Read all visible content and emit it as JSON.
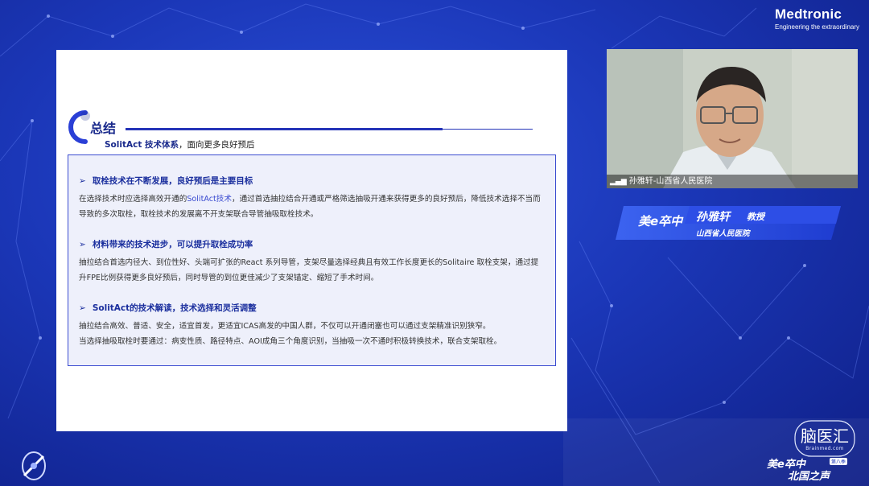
{
  "brand": {
    "name": "Medtronic",
    "tagline": "Engineering the extraordinary"
  },
  "slide": {
    "heading": "总结",
    "subtitle_em": "SolitAct 技术体系",
    "subtitle_rest": "，面向更多良好预后",
    "sections": [
      {
        "arrow": "➢",
        "title": "取栓技术在不断发展，良好预后是主要目标",
        "text_a": "在选择技术时应选择高效开通的",
        "text_hl": "SolitAct技术",
        "text_b": "，通过首选抽拉结合开通或严格筛选抽吸开通来获得更多的良好预后，降低技术选择不当而导致的多次取栓，取栓技术的发展离不开支架联合导管抽吸取栓技术。"
      },
      {
        "arrow": "➢",
        "title": "材料带来的技术进步，可以提升取栓成功率",
        "text": "抽拉结合首选内径大、到位性好、头端可扩张的React 系列导管，支架尽量选择经典且有效工作长度更长的Solitaire 取栓支架，通过提升FPE比例获得更多良好预后，同时导管的到位更佳减少了支架锚定、缩短了手术时间。"
      },
      {
        "arrow": "➢",
        "title": "SolitAct的技术解读，技术选择和灵活调整",
        "line1": "抽拉结合高效、普适、安全，适宜首发，更适宜ICAS高发的中国人群，不仅可以开通闭塞也可以通过支架精准识别狭窄。",
        "line2": "当选择抽吸取栓时要通过：病变性质、路径特点、AOI成角三个角度识别，当抽吸一次不通时积极转换技术，联合支架取栓。"
      }
    ]
  },
  "webcam": {
    "caption": "孙雅轩-山西省人民医院",
    "signal_icon": "signal-bars-icon"
  },
  "banner": {
    "brand": "美e卒中",
    "speaker_name": "孙雅轩",
    "speaker_title": "教授",
    "organization": "山西省人民医院"
  },
  "watermarks": {
    "naoyihui": "脑医汇",
    "naoyihui_url": "Brainmed.com",
    "series_brand": "美e卒中",
    "series_tag": "第八季",
    "series_sub": "北国之声"
  },
  "colors": {
    "accent": "#2534b8",
    "background": "#1b37b8",
    "highlight": "#3a4bd0"
  }
}
